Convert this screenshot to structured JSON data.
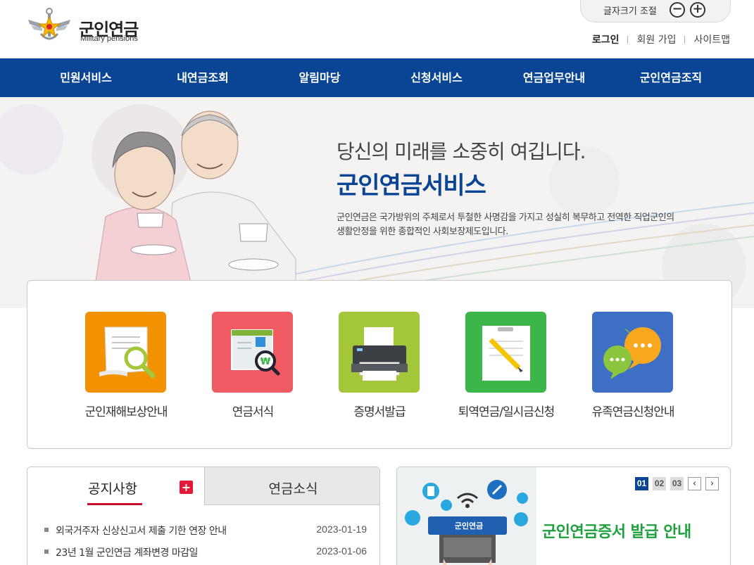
{
  "header": {
    "logo_title": "군인연금",
    "logo_subtitle": "Military pensions",
    "fontsize_label": "글자크기 조절",
    "fontsize_minus": "−",
    "fontsize_plus": "+",
    "util_links": [
      "로그인",
      "회원 가입",
      "사이트맵"
    ]
  },
  "nav": [
    "민원서비스",
    "내연금조회",
    "알림마당",
    "신청서비스",
    "연금업무안내",
    "군인연금조직"
  ],
  "visual": {
    "subtitle": "당신의 미래를 소중히 여깁니다.",
    "title": "군인연금서비스",
    "desc_line1": "군인연금은 국가방위의 주체로서 투철한 사명감을 가지고 성실히 복무하고 전역한 직업군인의",
    "desc_line2": "생활안정을 위한 종합적인 사회보장제도입니다."
  },
  "quick_menu": [
    {
      "label": "군인재해보상안내",
      "icon": "document-search-icon",
      "color": "#f39200"
    },
    {
      "label": "연금서식",
      "icon": "form-won-search-icon",
      "color": "#ef5a63"
    },
    {
      "label": "증명서발급",
      "icon": "printer-icon",
      "color": "#a4c639"
    },
    {
      "label": "퇴역연금/일시금신청",
      "icon": "paper-pencil-icon",
      "color": "#3cb54a"
    },
    {
      "label": "유족연금신청안내",
      "icon": "chat-bubbles-icon",
      "color": "#3d6fc4"
    }
  ],
  "notice": {
    "tab_active": "공지사항",
    "tab_plus": "+",
    "tab_inactive": "연금소식",
    "items": [
      {
        "title": "외국거주자 신상신고서 제출 기한 연장 안내",
        "date": "2023-01-19"
      },
      {
        "title": "23년 1월 군인연금 계좌변경 마감일",
        "date": "2023-01-06"
      }
    ]
  },
  "banner": {
    "text": "군인연금증서 발급 안내",
    "screen_label": "군인연금",
    "pages": [
      "01",
      "02",
      "03"
    ],
    "prev": "‹",
    "next": "›"
  },
  "colors": {
    "nav_bg": "#0a4595",
    "title_blue": "#0a4595",
    "accent_red": "#e31937",
    "banner_green": "#1ea03c"
  }
}
